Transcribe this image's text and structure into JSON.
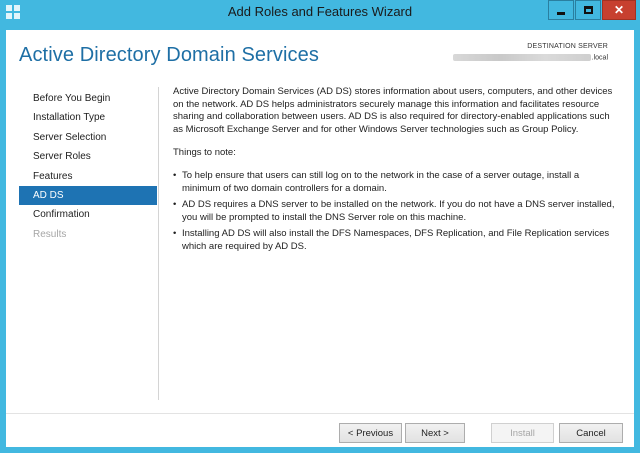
{
  "window": {
    "title": "Add Roles and Features Wizard",
    "close_glyph": "✕"
  },
  "header": {
    "page_title": "Active Directory Domain Services",
    "destination_label": "DESTINATION SERVER",
    "destination_value": ".local"
  },
  "nav": {
    "items": [
      {
        "label": "Before You Begin",
        "state": "normal"
      },
      {
        "label": "Installation Type",
        "state": "normal"
      },
      {
        "label": "Server Selection",
        "state": "normal"
      },
      {
        "label": "Server Roles",
        "state": "normal"
      },
      {
        "label": "Features",
        "state": "normal"
      },
      {
        "label": "AD DS",
        "state": "active"
      },
      {
        "label": "Confirmation",
        "state": "normal"
      },
      {
        "label": "Results",
        "state": "disabled"
      }
    ]
  },
  "content": {
    "intro": "Active Directory Domain Services (AD DS) stores information about users, computers, and other devices on the network.  AD DS helps administrators securely manage this information and facilitates resource sharing and collaboration between users.  AD DS is also required for directory-enabled applications such as Microsoft Exchange Server and for other Windows Server technologies such as Group Policy.",
    "notes_heading": "Things to note:",
    "bullet_glyph": "•",
    "notes": [
      "To help ensure that users can still log on to the network in the case of a server outage, install a minimum of two domain controllers for a domain.",
      "AD DS requires a DNS server to be installed on the network.  If you do not have a DNS server installed, you will be prompted to install the DNS Server role on this machine.",
      "Installing AD DS will also install the DFS Namespaces, DFS Replication, and File Replication services which are required by AD DS."
    ]
  },
  "footer": {
    "previous_label": "< Previous",
    "next_label": "Next >",
    "install_label": "Install",
    "cancel_label": "Cancel"
  },
  "colors": {
    "title_bar": "#42b8e0",
    "close_button": "#c7402f",
    "header_title": "#1e6fa5",
    "nav_active": "#1e73b3",
    "disabled_text": "#a6a6a6"
  }
}
